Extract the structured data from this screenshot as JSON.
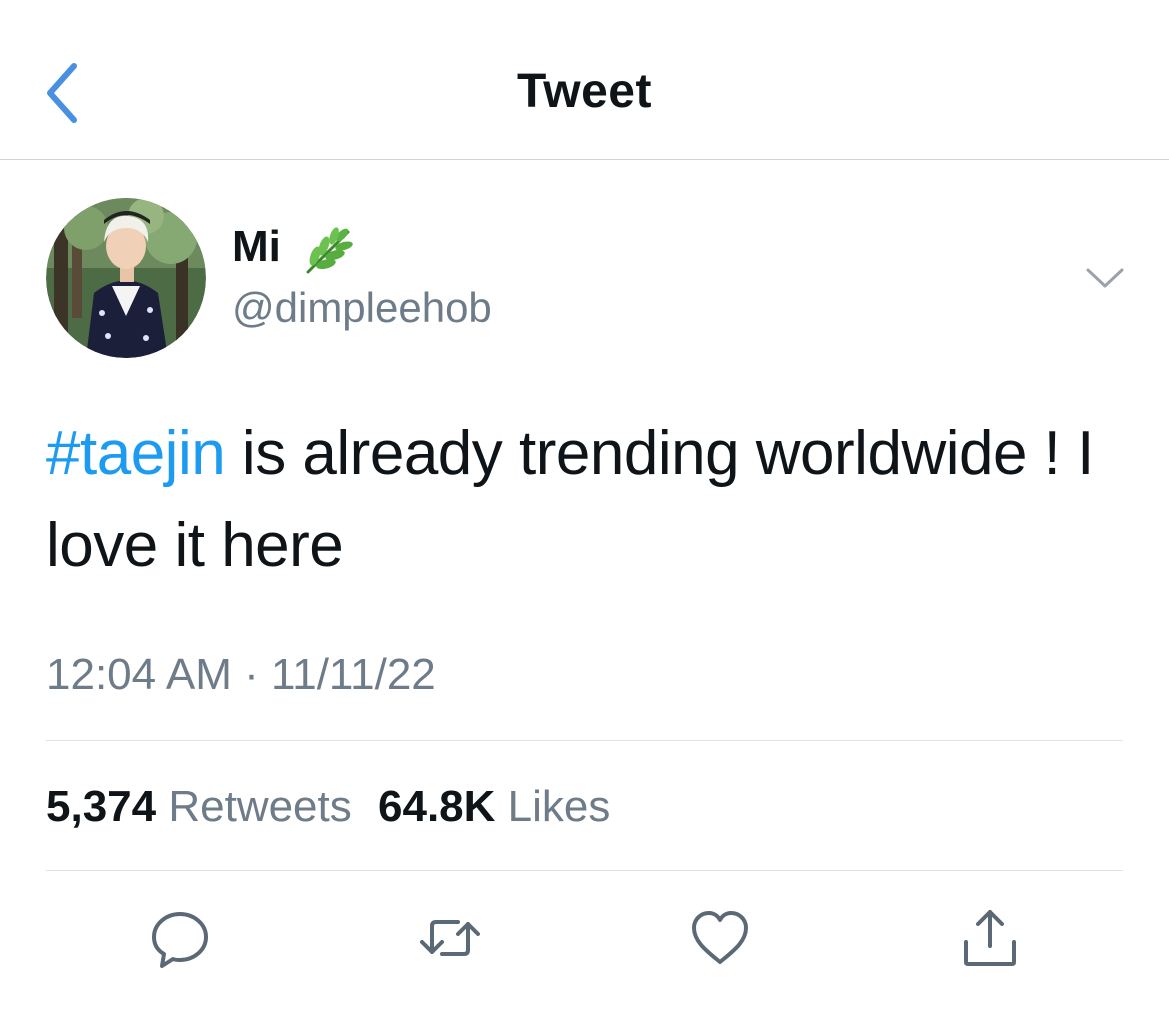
{
  "header": {
    "title": "Tweet",
    "back_icon": "chevron-left-icon"
  },
  "author": {
    "name": "Mi",
    "name_emoji": "herb-icon",
    "handle": "@dimpleehob"
  },
  "tweet": {
    "hashtag": "#taejin",
    "text_rest": " is already trending worldwide ! I love it here",
    "time": "12:04 AM",
    "separator": "·",
    "date": "11/11/22"
  },
  "stats": {
    "retweets_count": "5,374",
    "retweets_label": "Retweets",
    "likes_count": "64.8K",
    "likes_label": "Likes"
  },
  "actions": [
    "reply-icon",
    "retweet-icon",
    "like-icon",
    "share-icon"
  ],
  "colors": {
    "link": "#1d9bf0",
    "text": "#0f1419",
    "secondary": "#6e7b88",
    "icon": "#5b6875",
    "divider": "#dfe3e7"
  }
}
